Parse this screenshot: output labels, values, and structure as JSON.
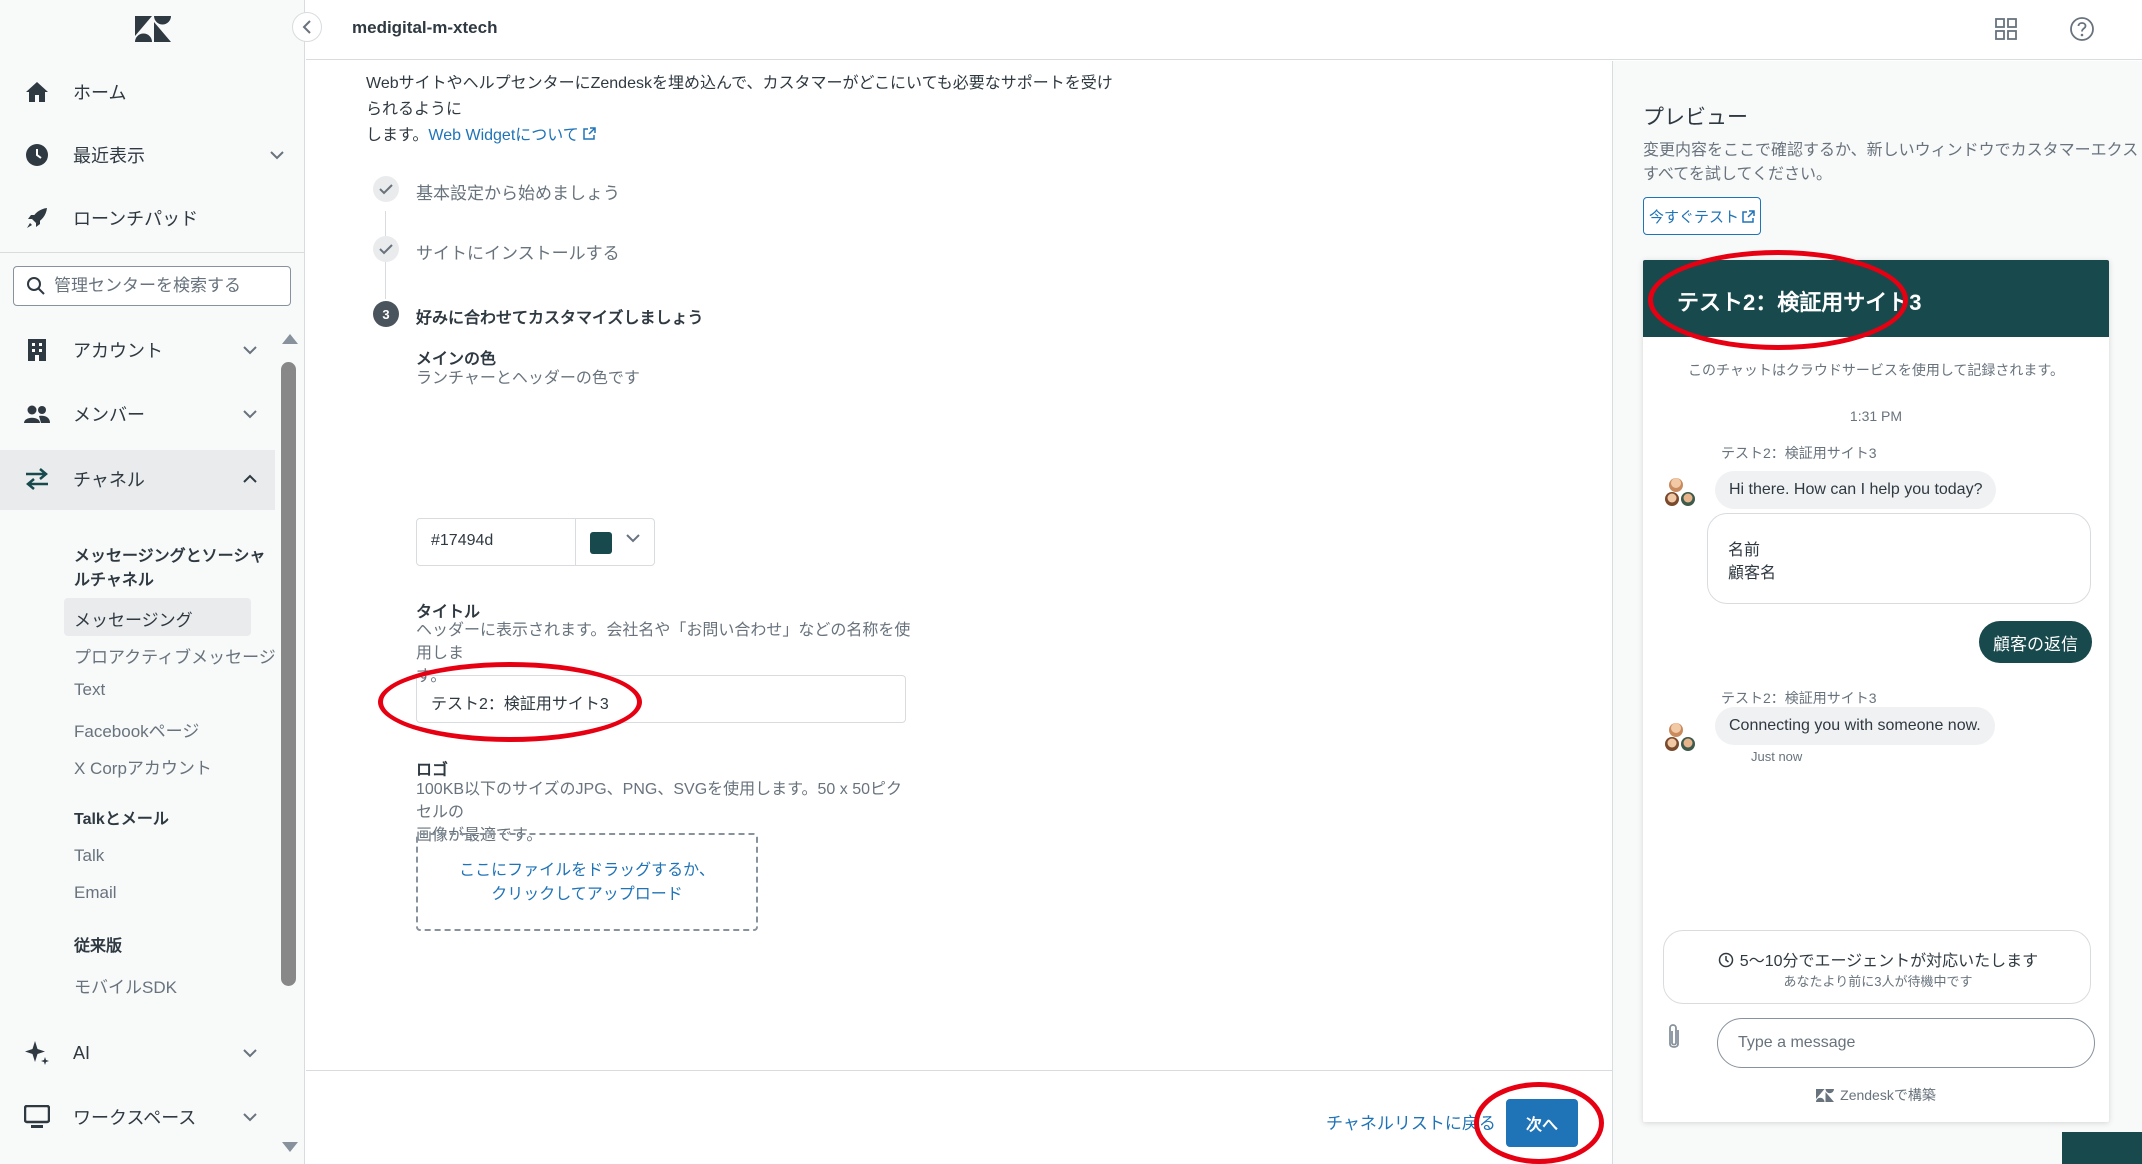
{
  "nav": {
    "home": "ホーム",
    "recent": "最近表示",
    "launchpad": "ローンチパッド",
    "search_placeholder": "管理センターを検索する",
    "account": "アカウント",
    "members": "メンバー",
    "channels": "チャネル",
    "messaging_social_head_1": "メッセージングとソーシャ",
    "messaging_social_head_2": "ルチャネル",
    "messaging": "メッセージング",
    "proactive": "プロアクティブメッセージ",
    "text": "Text",
    "facebook": "Facebookページ",
    "xcorp": "X Corpアカウント",
    "talk_email_head": "Talkとメール",
    "talk": "Talk",
    "email": "Email",
    "legacy_head": "従来版",
    "mobile_sdk": "モバイルSDK",
    "ai": "AI",
    "workspace": "ワークスペース"
  },
  "header": {
    "account_name": "medigital-m-xtech"
  },
  "main": {
    "intro_line1": "WebサイトやヘルプセンターにZendeskを埋め込んで、カスタマーがどこにいても必要なサポートを受けられるように",
    "intro_line2": "します。",
    "intro_link": "Web Widgetについて",
    "step1": "基本設定から始めましょう",
    "step2": "サイトにインストールする",
    "step3_num": "3",
    "step3": "好みに合わせてカスタマイズしましょう",
    "color_label": "メインの色",
    "color_hint": "ランチャーとヘッダーの色です",
    "color_value": "#17494d",
    "title_label": "タイトル",
    "title_hint_1": "ヘッダーに表示されます。会社名や「お問い合わせ」などの名称を使用しま",
    "title_hint_2": "す。",
    "title_value": "テスト2：検証用サイト3",
    "logo_label": "ロゴ",
    "logo_hint_1": "100KB以下のサイズのJPG、PNG、SVGを使用します。50 x 50ピクセルの",
    "logo_hint_2": "画像が最適です。",
    "dropzone_1": "ここにファイルをドラッグするか、",
    "dropzone_2": "クリックしてアップロード"
  },
  "footer": {
    "back": "チャネルリストに戻る",
    "next": "次へ"
  },
  "preview": {
    "title": "プレビュー",
    "desc_1": "変更内容をここで確認するか、新しいウィンドウでカスタマーエクスペリエンスの",
    "desc_2": "すべてを試してください。",
    "test_now": "今すぐテスト",
    "widget_title": "テスト2：検証用サイト3",
    "record_note": "このチャットはクラウドサービスを使用して記録されます。",
    "time": "1:31 PM",
    "sender_1": "テスト2：検証用サイト3",
    "msg_1": "Hi there. How can I help you today?",
    "form_name_label": "名前",
    "form_name_value": "顧客名",
    "reply": "顧客の返信",
    "sender_2": "テスト2：検証用サイト3",
    "msg_2": "Connecting you with someone now.",
    "just_now": "Just now",
    "wait_1": "5〜10分でエージェントが対応いたします",
    "wait_2": "あなたより前に3人が待機中です",
    "input_placeholder": "Type a message",
    "powered": "Zendeskで構築"
  },
  "colors": {
    "brand": "#17494d",
    "link": "#1f73b7",
    "annotation": "#e60012"
  }
}
